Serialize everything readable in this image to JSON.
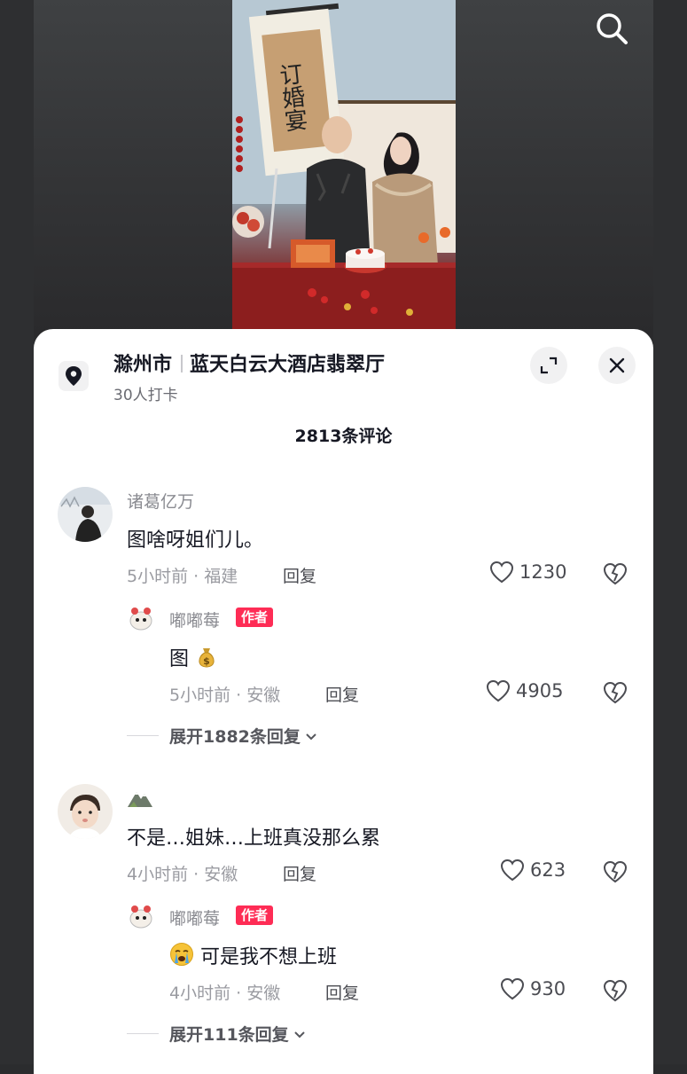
{
  "video": {
    "sign_text": "订婚宴"
  },
  "location": {
    "city": "滁州市",
    "venue": "蓝天白云大酒店翡翠厅",
    "checkins": "30人打卡"
  },
  "comments_count_label": "2813条评论",
  "comments": [
    {
      "user": "诸葛亿万",
      "text": "图啥呀姐们儿。",
      "meta": "5小时前 · 福建",
      "reply_label": "回复",
      "likes": "1230",
      "reply": {
        "user": "嘟嘟莓",
        "badge": "作者",
        "text": "图",
        "emoji": "money-bag",
        "meta": "5小时前 · 安徽",
        "reply_label": "回复",
        "likes": "4905"
      },
      "expand_label": "展开1882条回复"
    },
    {
      "user": "",
      "user_icon": "mountain-emoji",
      "text": "不是…姐妹…上班真没那么累",
      "meta": "4小时前 · 安徽",
      "reply_label": "回复",
      "likes": "623",
      "reply": {
        "user": "嘟嘟莓",
        "badge": "作者",
        "text": "可是我不想上班",
        "emoji": "crying-face",
        "meta": "4小时前 · 安徽",
        "reply_label": "回复",
        "likes": "930"
      },
      "expand_label": "展开111条回复"
    }
  ],
  "colors": {
    "accent": "#fe2c55",
    "text": "#161823",
    "muted": "#8a8b91"
  }
}
